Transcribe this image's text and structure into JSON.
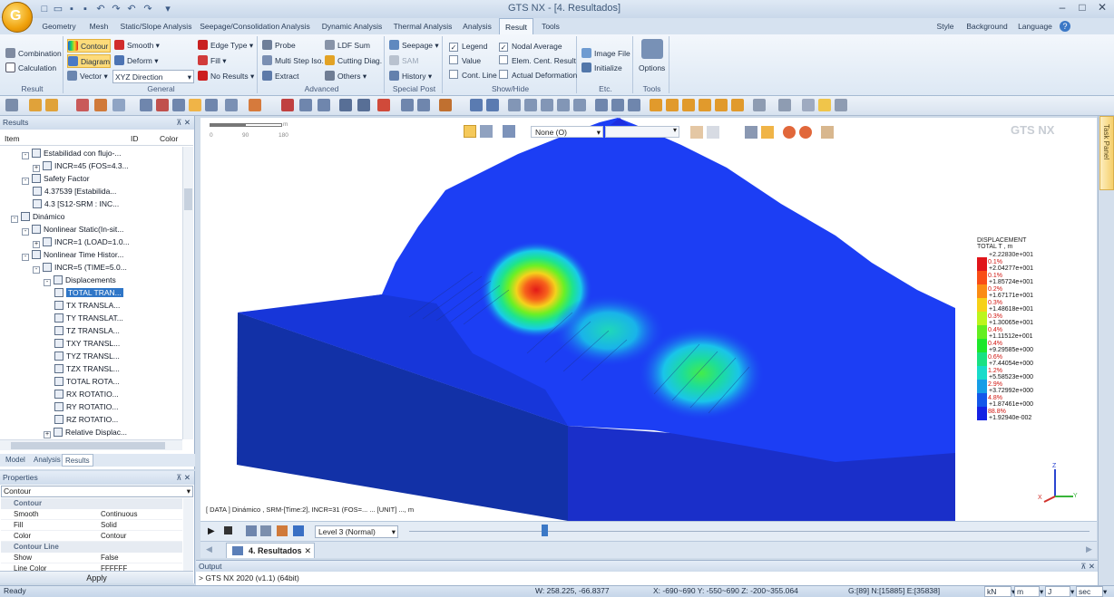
{
  "window": {
    "title": "GTS NX - [4. Resultados]"
  },
  "menu_tabs": [
    "Geometry",
    "Mesh",
    "Static/Slope Analysis",
    "Seepage/Consolidation Analysis",
    "Dynamic Analysis",
    "Thermal Analysis",
    "Analysis",
    "Result",
    "Tools"
  ],
  "active_tab": "Result",
  "right_menus": [
    "Style",
    "Background",
    "Language"
  ],
  "ribbon": {
    "result_group": {
      "label": "Result",
      "items": [
        "Combination",
        "Calculation"
      ]
    },
    "general_group": {
      "label": "General",
      "contour": "Contour",
      "diagram": "Diagram",
      "vector": "Vector",
      "smooth": "Smooth",
      "deform": "Deform",
      "direction": "XYZ Direction",
      "edge_type": "Edge Type",
      "fill": "Fill",
      "no_results": "No Results"
    },
    "advanced_group": {
      "label": "Advanced",
      "probe": "Probe",
      "multi_step": "Multi Step Iso.",
      "extract": "Extract",
      "ldf_sum": "LDF Sum",
      "cutting_diag": "Cutting Diag.",
      "others": "Others"
    },
    "special_group": {
      "label": "Special Post",
      "seepage": "Seepage",
      "sam": "SAM",
      "history": "History"
    },
    "showhide_group": {
      "label": "Show/Hide",
      "legend": "Legend",
      "value": "Value",
      "cont_line": "Cont. Line",
      "nodal_average": "Nodal Average",
      "elem_cent": "Elem. Cent. Result",
      "actual_def": "Actual Deformation"
    },
    "etc_group": {
      "label": "Etc.",
      "image_file": "Image File",
      "initialize": "Initialize"
    },
    "tools_group": {
      "label": "Tools",
      "options": "Options"
    }
  },
  "results_panel": {
    "title": "Results",
    "columns": [
      "Item",
      "ID",
      "Color"
    ],
    "tree": [
      {
        "indent": 1,
        "exp": "-",
        "label": "Estabilidad con flujo-..."
      },
      {
        "indent": 2,
        "exp": "+",
        "label": "INCR=45 (FOS=4.3..."
      },
      {
        "indent": 1,
        "exp": "-",
        "label": "Safety Factor"
      },
      {
        "indent": 2,
        "exp": "",
        "label": "4.37539 [Estabilida..."
      },
      {
        "indent": 2,
        "exp": "",
        "label": "4.3 [S12-SRM : INC..."
      },
      {
        "indent": 0,
        "exp": "-",
        "label": "Dinámico"
      },
      {
        "indent": 1,
        "exp": "-",
        "label": "Nonlinear Static(In-sit..."
      },
      {
        "indent": 2,
        "exp": "+",
        "label": "INCR=1 (LOAD=1.0..."
      },
      {
        "indent": 1,
        "exp": "-",
        "label": "Nonlinear Time Histor..."
      },
      {
        "indent": 2,
        "exp": "-",
        "label": "INCR=5 (TIME=5.0..."
      },
      {
        "indent": 3,
        "exp": "-",
        "label": "Displacements"
      },
      {
        "indent": 4,
        "exp": "",
        "label": "TOTAL TRAN...",
        "selected": true
      },
      {
        "indent": 4,
        "exp": "",
        "label": "TX TRANSLA..."
      },
      {
        "indent": 4,
        "exp": "",
        "label": "TY TRANSLAT..."
      },
      {
        "indent": 4,
        "exp": "",
        "label": "TZ TRANSLA..."
      },
      {
        "indent": 4,
        "exp": "",
        "label": "TXY TRANSL..."
      },
      {
        "indent": 4,
        "exp": "",
        "label": "TYZ TRANSL..."
      },
      {
        "indent": 4,
        "exp": "",
        "label": "TZX TRANSL..."
      },
      {
        "indent": 4,
        "exp": "",
        "label": "TOTAL ROTA..."
      },
      {
        "indent": 4,
        "exp": "",
        "label": "RX ROTATIO..."
      },
      {
        "indent": 4,
        "exp": "",
        "label": "RY ROTATIO..."
      },
      {
        "indent": 4,
        "exp": "",
        "label": "RZ ROTATIO..."
      },
      {
        "indent": 3,
        "exp": "+",
        "label": "Relative Displac..."
      }
    ],
    "bottom_tabs": [
      "Model",
      "Analysis",
      "Results"
    ]
  },
  "properties": {
    "title": "Properties",
    "selector": "Contour",
    "rows": [
      {
        "cat": "Contour"
      },
      {
        "k": "Smooth",
        "v": "Continuous"
      },
      {
        "k": "Fill",
        "v": "Solid"
      },
      {
        "k": "Color",
        "v": "Contour"
      },
      {
        "cat": "Contour Line"
      },
      {
        "k": "Show",
        "v": "False"
      },
      {
        "k": "Line Color",
        "v": "FFFFFF"
      }
    ],
    "apply": "Apply"
  },
  "viewport": {
    "scale_labels": [
      "0",
      "90",
      "180"
    ],
    "scale_unit": "m",
    "render_mode": "None (O)",
    "watermark": "GTS NX",
    "info_line": "[ DATA ] Dinámico , SRM-[Time:2], INCR=31 (FOS=...  ...  [UNIT] ..., m",
    "legend": {
      "title1": "DISPLACEMENT",
      "title2": "TOTAL T , m",
      "top_value": "+2.22830e+001",
      "colors": [
        "#e0151a",
        "#f94d16",
        "#fb8c14",
        "#f6d118",
        "#bcf51d",
        "#64ee20",
        "#1ee72b",
        "#19e183",
        "#18dbca",
        "#159de7",
        "#1457ea",
        "#1522e4"
      ],
      "pcts": [
        "0.1%",
        "0.1%",
        "0.2%",
        "0.3%",
        "0.3%",
        "0.4%",
        "0.4%",
        "0.6%",
        "1.2%",
        "2.9%",
        "4.8%",
        "88.8%"
      ],
      "values": [
        "+2.04277e+001",
        "+1.85724e+001",
        "+1.67171e+001",
        "+1.48618e+001",
        "+1.30065e+001",
        "+1.11512e+001",
        "+9.29585e+000",
        "+7.44054e+000",
        "+5.58523e+000",
        "+3.72992e+000",
        "+1.87461e+000",
        "+1.92940e-002"
      ]
    },
    "axes": {
      "z": "Z",
      "x": "X",
      "y": "Y"
    }
  },
  "animation_bar": {
    "level": "Level 3 (Normal)"
  },
  "doc_tab": "4. Resultados",
  "output": {
    "title": "Output",
    "line": "> GTS NX 2020 (v1.1) (64bit)"
  },
  "right_panel_label": "Task Panel",
  "status": {
    "ready": "Ready",
    "w": "W: 258.225, -66.8377",
    "coords": "X: -690~690 Y: -550~690 Z: -200~355.064",
    "g": "G:[89] N:[15885] E:[35838]",
    "units": [
      "kN",
      "m",
      "J",
      "sec"
    ]
  }
}
